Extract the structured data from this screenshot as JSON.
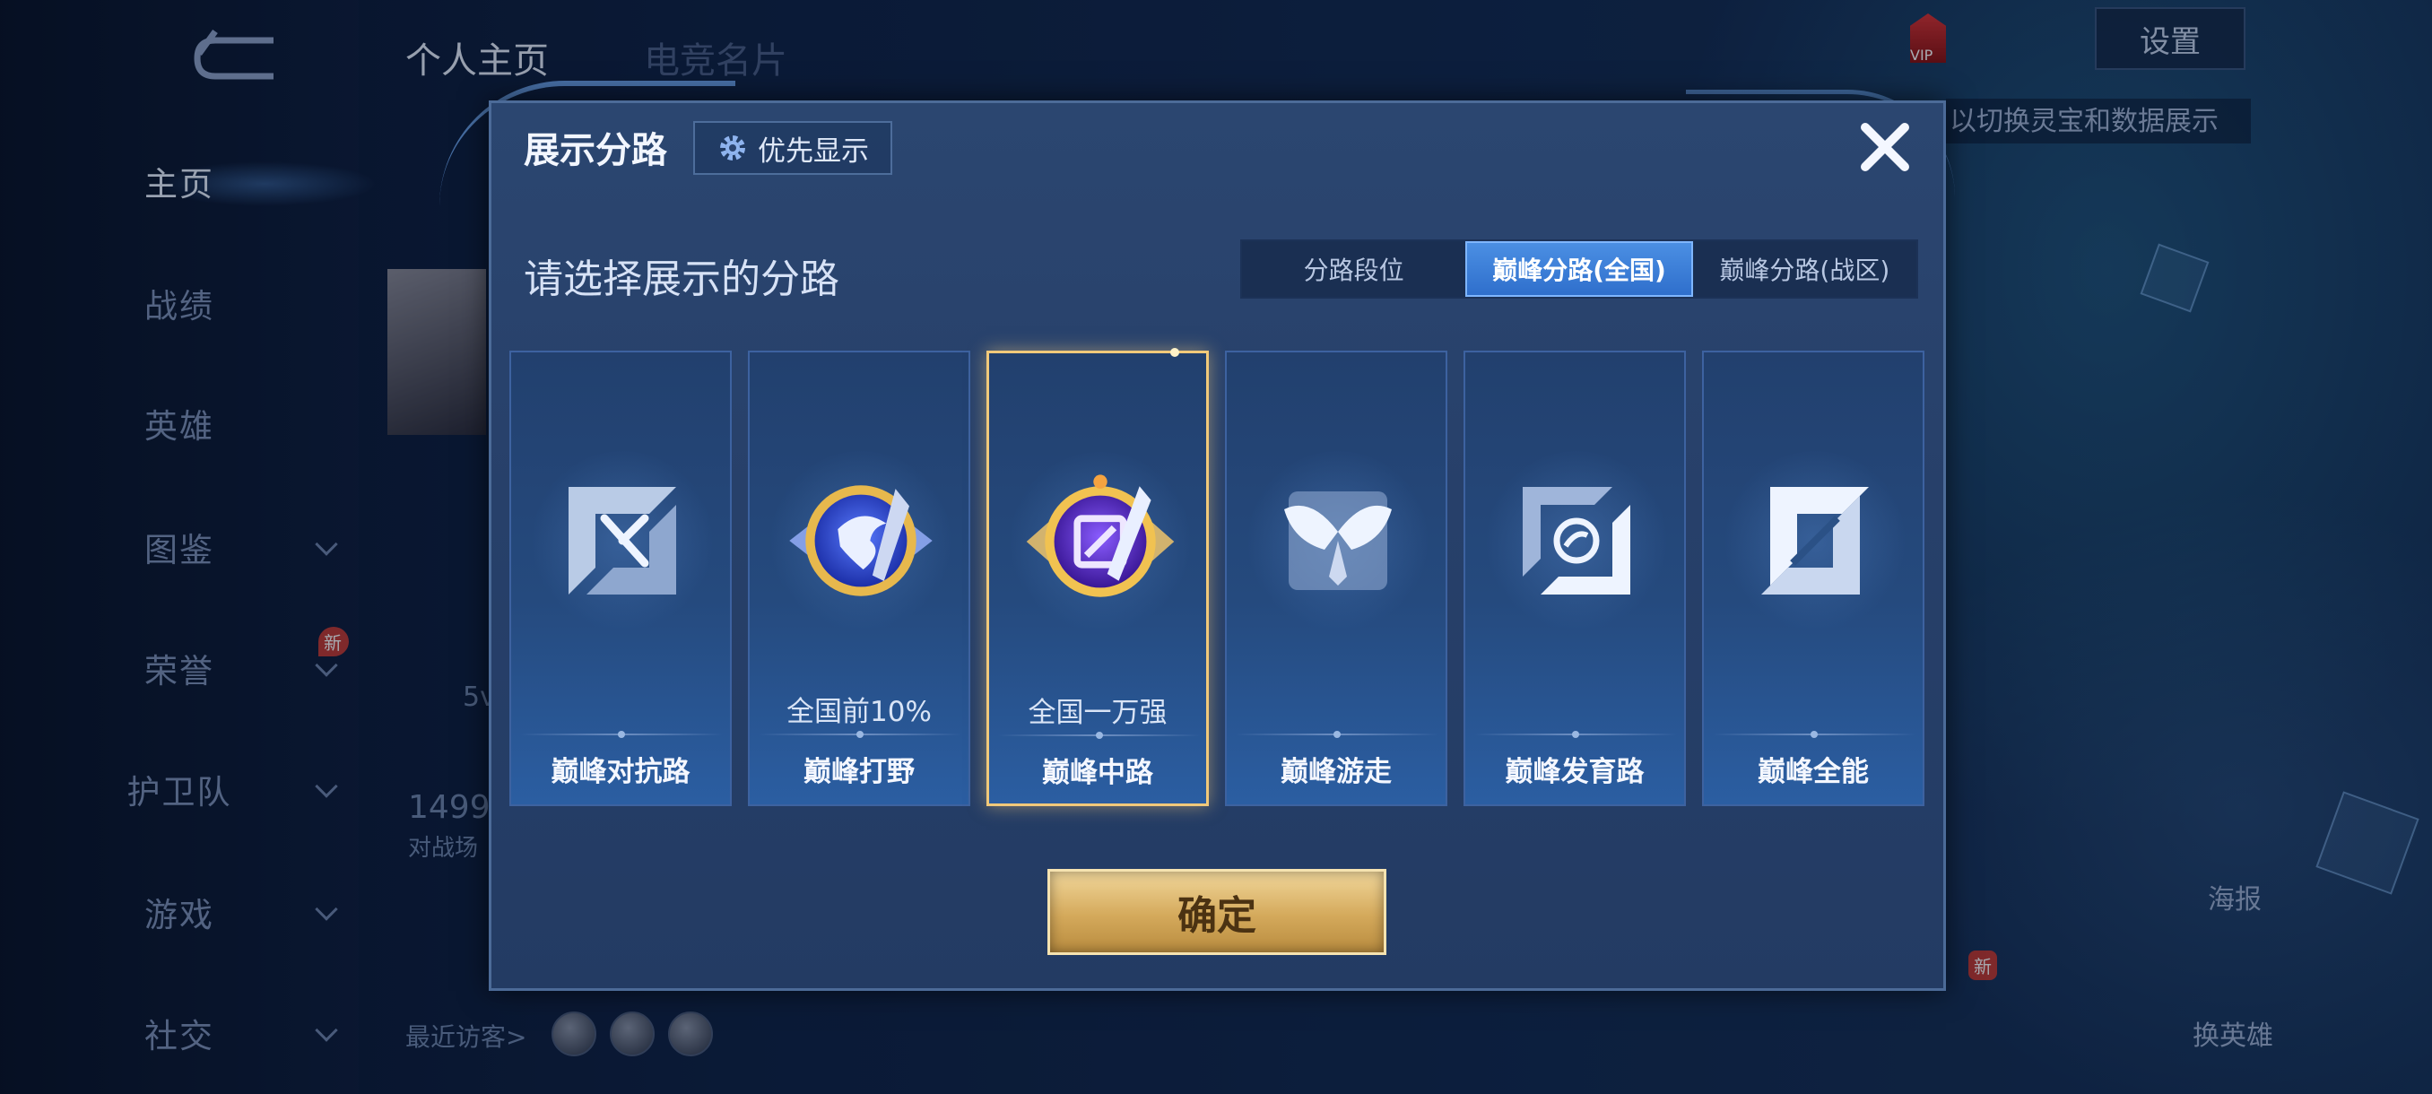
{
  "nav": {
    "items": [
      {
        "label": "主页",
        "active": true,
        "has_chevron": false
      },
      {
        "label": "战绩",
        "active": false,
        "has_chevron": false
      },
      {
        "label": "英雄",
        "active": false,
        "has_chevron": false
      },
      {
        "label": "图鉴",
        "active": false,
        "has_chevron": true
      },
      {
        "label": "荣誉",
        "active": false,
        "has_chevron": true,
        "badge": "新"
      },
      {
        "label": "护卫队",
        "active": false,
        "has_chevron": true
      },
      {
        "label": "游戏",
        "active": false,
        "has_chevron": true
      },
      {
        "label": "社交",
        "active": false,
        "has_chevron": true
      }
    ]
  },
  "background": {
    "tabs": [
      "个人主页",
      "电竞名片"
    ],
    "fragments": {
      "five_v": "5v",
      "score": "1499",
      "score_label": "对战场"
    },
    "recent_visitors_label": "最近访客>",
    "settings_label": "设置",
    "tip_text": "以切换灵宝和数据展示",
    "side_buttons": [
      "海报",
      "换英雄"
    ],
    "new_badge": "新",
    "vip_label": "VIP"
  },
  "modal": {
    "title": "展示分路",
    "priority_button": "优先显示",
    "subtitle": "请选择展示的分路",
    "segment_tabs": [
      {
        "label": "分路段位",
        "active": false
      },
      {
        "label": "巅峰分路(全国)",
        "active": true
      },
      {
        "label": "巅峰分路(战区)",
        "active": false
      }
    ],
    "lanes": [
      {
        "name": "巅峰对抗路",
        "rank": "",
        "icon": "clash-lane-icon",
        "selected": false
      },
      {
        "name": "巅峰打野",
        "rank": "全国前10%",
        "icon": "jungle-emblem-icon",
        "selected": false
      },
      {
        "name": "巅峰中路",
        "rank": "全国一万强",
        "icon": "mid-lane-emblem-icon",
        "selected": true
      },
      {
        "name": "巅峰游走",
        "rank": "",
        "icon": "roam-wings-icon",
        "selected": false
      },
      {
        "name": "巅峰发育路",
        "rank": "",
        "icon": "farm-lane-icon",
        "selected": false
      },
      {
        "name": "巅峰全能",
        "rank": "",
        "icon": "all-round-icon",
        "selected": false
      }
    ],
    "confirm_button": "确定"
  },
  "colors": {
    "accent_blue": "#2f6fcc",
    "gold": "#d4a95b",
    "modal_bg": "#27406a"
  }
}
